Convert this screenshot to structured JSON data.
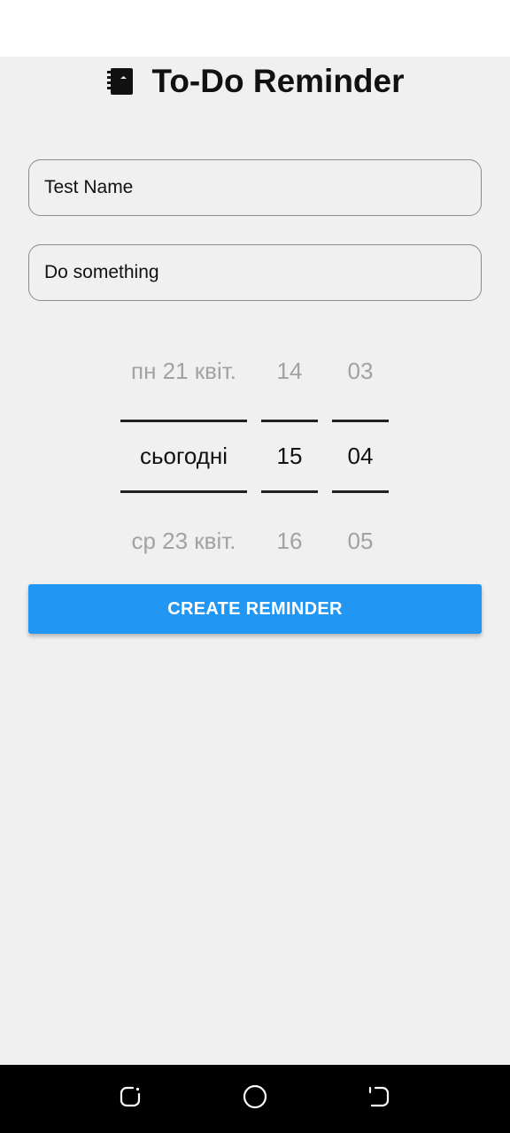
{
  "app": {
    "title": "To-Do Reminder",
    "icon": "notebook-icon"
  },
  "form": {
    "name_value": "Test Name",
    "description_value": "Do something"
  },
  "picker": {
    "date": {
      "prev": "пн 21 квіт.",
      "current": "сьогодні",
      "next": "ср 23 квіт."
    },
    "hour": {
      "prev": "14",
      "current": "15",
      "next": "16"
    },
    "minute": {
      "prev": "03",
      "current": "04",
      "next": "05"
    }
  },
  "button": {
    "create_label": "CREATE REMINDER",
    "color": "#2196f3"
  },
  "nav": {
    "recents_icon": "recents-icon",
    "home_icon": "home-icon",
    "back_icon": "back-icon"
  }
}
